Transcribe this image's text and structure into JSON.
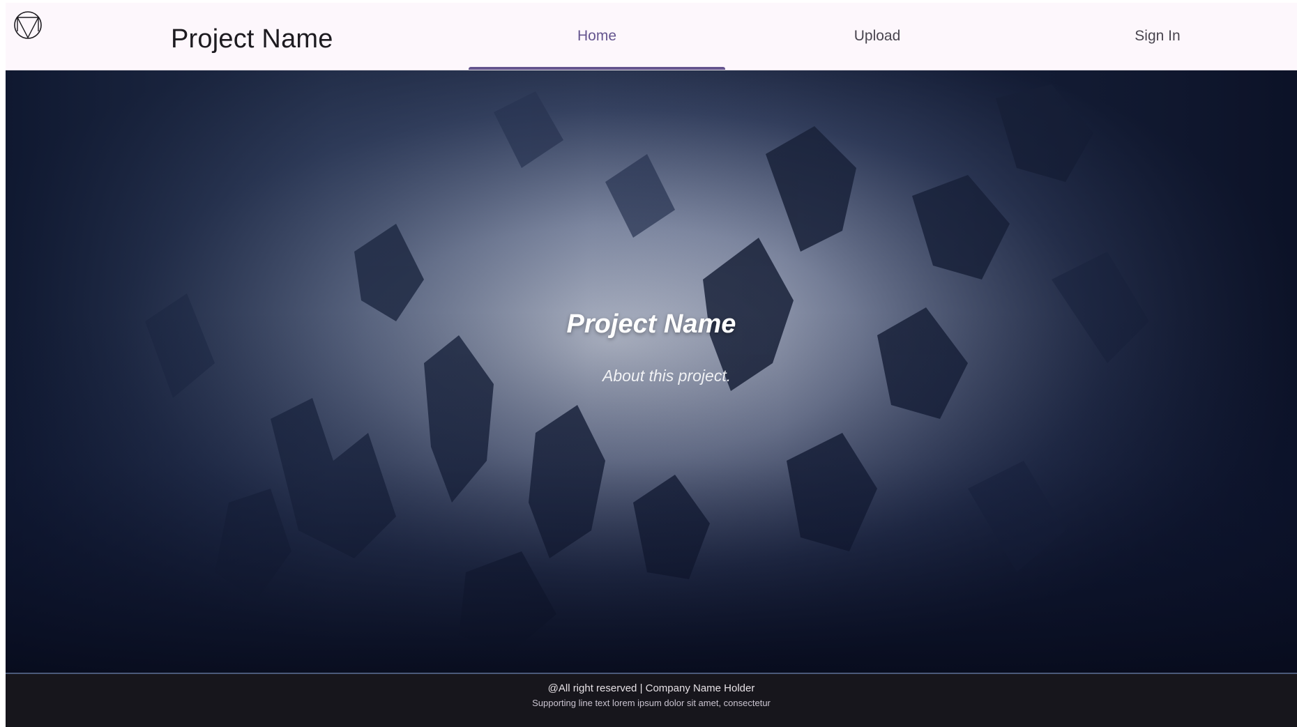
{
  "header": {
    "brand": "Project Name",
    "logo_icon": "circle-triangle-logo-icon",
    "tabs": [
      {
        "label": "Home",
        "active": true
      },
      {
        "label": "Upload",
        "active": false
      },
      {
        "label": "Sign In",
        "active": false
      }
    ]
  },
  "hero": {
    "title": "Project Name",
    "subtitle": "About this project.",
    "background": "snowy-mountain-image"
  },
  "footer": {
    "line1": "@All right reserved | Company Name Holder",
    "line2": "Supporting line text lorem ipsum dolor sit amet, consectetur"
  },
  "colors": {
    "accent": "#65558f",
    "header_bg": "#fdf7fc",
    "footer_bg": "#17161c",
    "hero_dark": "#1f2a44"
  }
}
